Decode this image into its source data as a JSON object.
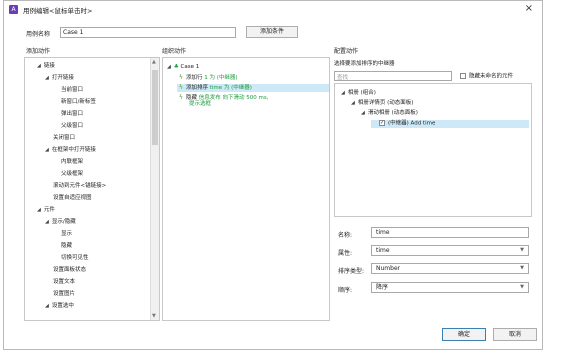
{
  "window": {
    "title": "用例编辑<鼠标单击时>",
    "close": "×"
  },
  "case_name": {
    "label": "用例名称",
    "value": "Case 1"
  },
  "add_condition": "添加条件",
  "headers": {
    "add_action": "添加动作",
    "organize_action": "组织动作",
    "configure_action": "配置动作"
  },
  "actions_tree": [
    "链接",
    "打开链接",
    "当前窗口",
    "新窗口/新标签",
    "弹出窗口",
    "父级窗口",
    "关闭窗口",
    "在框架中打开链接",
    "内联框架",
    "父级框架",
    "滚动到元件<锚链接>",
    "设置自适应视图",
    "元件",
    "显示/隐藏",
    "显示",
    "隐藏",
    "切换可见性",
    "设置面板状态",
    "设置文本",
    "设置图片",
    "设置选中"
  ],
  "organize": {
    "case": "Case 1",
    "items": [
      {
        "prefix": "添加行 ",
        "detail": "1 为 (中继器)"
      },
      {
        "prefix": "添加排序 ",
        "detail": "time 为 (中继器)"
      },
      {
        "prefix": "隐藏 ",
        "detail": "信息发布 向下滑动 500 ms,",
        "detail2": "提示选框"
      }
    ]
  },
  "configure": {
    "prompt": "选择要添加排序的中继器",
    "search_placeholder": "查找",
    "hide_unnamed": "隐藏未命名的元件",
    "tree": [
      "相册 (组合)",
      "相册详情页 (动态面板)",
      "滑动相册 (动态面板)",
      "(中继器) Add time"
    ]
  },
  "props": {
    "name_label": "名称:",
    "name_value": "time",
    "attr_label": "属性:",
    "attr_value": "time",
    "sort_type_label": "排序类型:",
    "sort_type_value": "Number",
    "order_label": "顺序:",
    "order_value": "降序"
  },
  "buttons": {
    "ok": "确定",
    "cancel": "取消"
  },
  "colors": {
    "accent": "#1d9c3b",
    "selection": "#cde8f6",
    "ok_border": "#3c7fb1"
  }
}
